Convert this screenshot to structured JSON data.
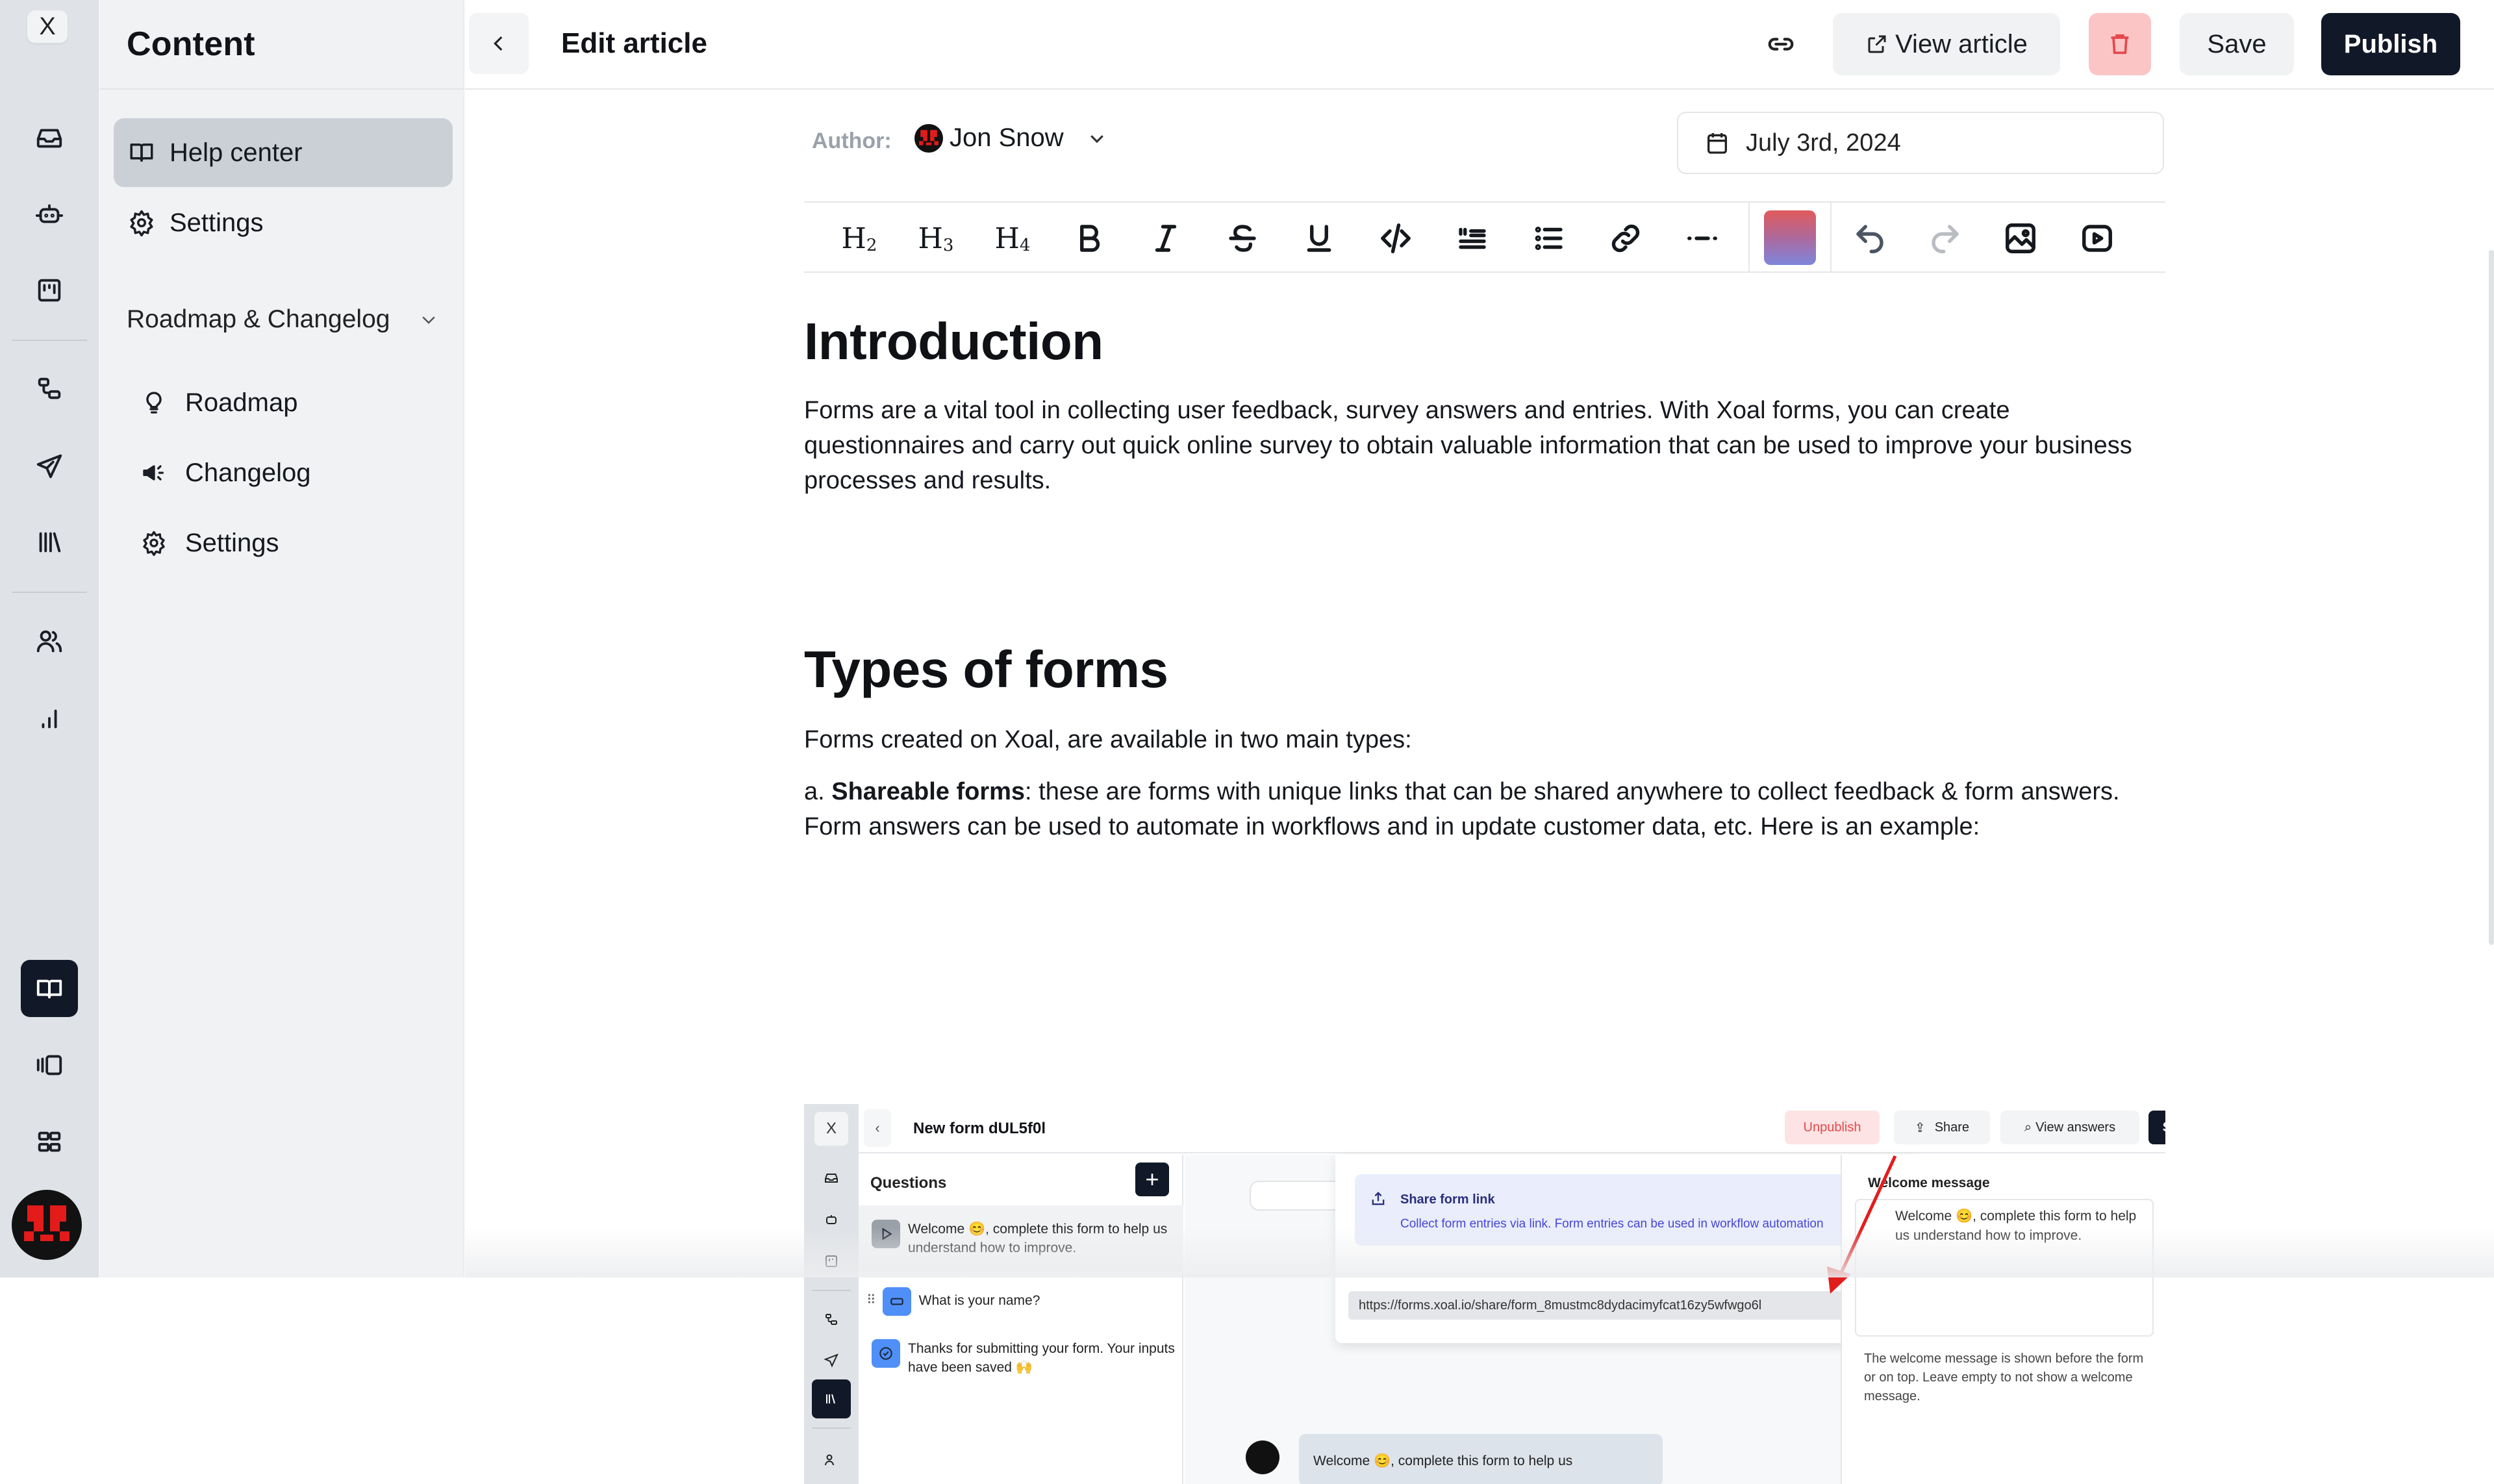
{
  "rail": {
    "close_label": "X",
    "icons": [
      "inbox-icon",
      "bot-icon",
      "board-icon",
      "workflow-icon",
      "send-icon",
      "library-icon",
      "users-icon",
      "analytics-icon",
      "book-icon",
      "carousel-icon",
      "apps-grid-icon"
    ],
    "active": "book-icon"
  },
  "sidebar": {
    "title": "Content",
    "items": [
      {
        "label": "Help center",
        "icon": "book-open-icon",
        "active": true
      },
      {
        "label": "Settings",
        "icon": "gear-icon",
        "active": false
      }
    ],
    "section": {
      "label": "Roadmap & Changelog",
      "expanded": true,
      "items": [
        {
          "label": "Roadmap",
          "icon": "lightbulb-icon"
        },
        {
          "label": "Changelog",
          "icon": "megaphone-icon"
        },
        {
          "label": "Settings",
          "icon": "gear-icon"
        }
      ]
    }
  },
  "topbar": {
    "title": "Edit article",
    "view_article": "View article",
    "save": "Save",
    "publish": "Publish"
  },
  "editor": {
    "author_label": "Author:",
    "author_name": "Jon Snow",
    "date": "July 3rd, 2024",
    "toolbar": {
      "h2": "H",
      "h2_sub": "2",
      "h3": "H",
      "h3_sub": "3",
      "h4": "H",
      "h4_sub": "4",
      "tools": [
        "bold",
        "italic",
        "strikethrough",
        "underline",
        "code",
        "blockquote",
        "bullet-list",
        "link",
        "horizontal-rule",
        "text-color",
        "undo",
        "redo",
        "image",
        "video"
      ],
      "redo_enabled": false
    }
  },
  "article": {
    "h1_intro": "Introduction",
    "p_intro": "Forms are a vital tool in collecting user feedback, survey answers and entries. With Xoal forms, you can create questionnaires and carry out quick online survey to obtain valuable information that can be used to improve your business processes and results.",
    "h1_types": "Types of forms",
    "p_types": "Forms created on Xoal, are available in two main types:",
    "p_a_prefix": "a. ",
    "p_a_bold": "Shareable forms",
    "p_a_rest": ": these are forms with unique links that can be shared anywhere to collect feedback & form answers. Form answers can be used to automate in workflows and in update customer data, etc. Here is an example:"
  },
  "embedded_screenshot": {
    "close_label": "X",
    "back": "‹",
    "title": "New form dUL5f0l",
    "unpublish": "Unpublish",
    "share": "Share",
    "view_answers": "View answers",
    "save": "Save",
    "questions_heading": "Questions",
    "add": "+",
    "questions": [
      {
        "text": "Welcome 😊, complete this form to help us understand how to improve.",
        "type": "welcome"
      },
      {
        "text": "What is your name?",
        "type": "short-text"
      },
      {
        "text": "Thanks for submitting your form. Your inputs have been saved 🙌",
        "type": "thank-you"
      }
    ],
    "share_popover": {
      "title": "Share form link",
      "description": "Collect form entries via link. Form entries can be used in workflow automation",
      "url": "https://forms.xoal.io/share/form_8mustmc8dydacimyfcat16zy5wfwgo6l"
    },
    "welcome_label": "Welcome message",
    "welcome_value": "Welcome 😊, complete this form to help us understand how to improve.",
    "welcome_help": "The welcome message is shown before the form or on top. Leave empty to not show a welcome message.",
    "chat_preview": "Welcome 😊, complete this form to help us",
    "accent_colors": {
      "arrow": "#e11d1d",
      "unpublish": "#e5484d",
      "share_title": "#2b2f7a",
      "share_desc": "#4646d9"
    }
  },
  "colors": {
    "rail_bg": "#dfe2e6",
    "sidebar_bg": "#f1f2f4",
    "active_item": "#cbcfd6",
    "primary": "#111827",
    "delete_bg": "#fcc5c5",
    "delete_icon": "#e5484d"
  }
}
